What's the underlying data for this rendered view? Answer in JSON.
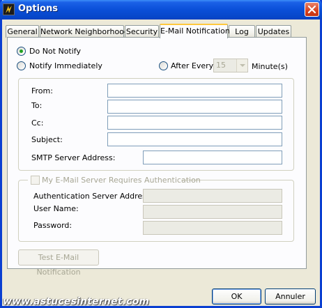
{
  "window": {
    "title": "Options"
  },
  "tabs": [
    {
      "label": "General"
    },
    {
      "label": "Network Neighborhood"
    },
    {
      "label": "Security"
    },
    {
      "label": "E-Mail Notification"
    },
    {
      "label": "Log"
    },
    {
      "label": "Updates"
    }
  ],
  "active_tab": "E-Mail Notification",
  "notify": {
    "do_not_notify": "Do Not Notify",
    "immediately": "Notify Immediately",
    "after_every": "After Every",
    "interval_value": "15",
    "interval_unit": "Minute(s)",
    "selected": "Do Not Notify"
  },
  "mail_fields": {
    "from": {
      "label": "From:",
      "value": ""
    },
    "to": {
      "label": "To:",
      "value": ""
    },
    "cc": {
      "label": "Cc:",
      "value": ""
    },
    "subject": {
      "label": "Subject:",
      "value": ""
    },
    "smtp": {
      "label": "SMTP Server Address:",
      "value": ""
    }
  },
  "auth": {
    "checkbox_label": "My E-Mail Server Requires Authentication",
    "checked": false,
    "server_label": "Authentication Server Address:",
    "user_label": "User Name:",
    "password_label": "Password:"
  },
  "buttons": {
    "test": "Test E-Mail Notification",
    "ok": "OK",
    "cancel": "Annuler"
  },
  "watermark": "www.astucesinternet.com"
}
